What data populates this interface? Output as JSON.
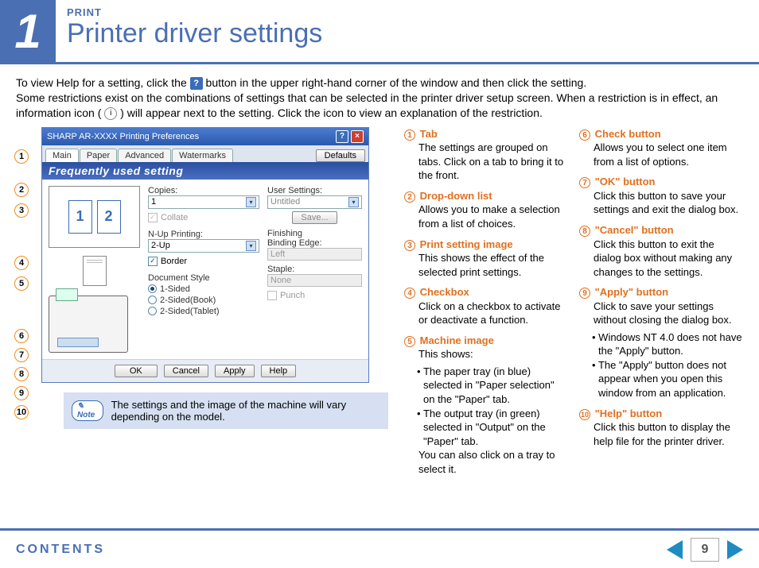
{
  "header": {
    "big_number": "1",
    "eyebrow": "PRINT",
    "title": "Printer driver settings"
  },
  "intro": {
    "line1a": "To view Help for a setting, click the ",
    "line1b": " button in the upper right-hand corner of the window and then click the setting.",
    "line2": "Some restrictions exist on the combinations of settings that can be selected in the printer driver setup screen. When a restriction is in effect, an information icon ( ",
    "line2b": " ) will appear next to the setting. Click the icon to view an explanation of the restriction."
  },
  "callout_labels": [
    "1",
    "2",
    "3",
    "4",
    "5",
    "6",
    "7",
    "8",
    "9",
    "10"
  ],
  "screenshot": {
    "title": "SHARP AR-XXXX Printing Preferences",
    "tabs": [
      "Main",
      "Paper",
      "Advanced",
      "Watermarks"
    ],
    "defaults_btn": "Defaults",
    "freq_bar": "Frequently used setting",
    "copies_label": "Copies:",
    "copies_value": "1",
    "collate_label": "Collate",
    "nup_label": "N-Up Printing:",
    "nup_value": "2-Up",
    "border_label": "Border",
    "docstyle_label": "Document Style",
    "radio1": "1-Sided",
    "radio2": "2-Sided(Book)",
    "radio3": "2-Sided(Tablet)",
    "usersettings_label": "User Settings:",
    "usersettings_value": "Untitled",
    "save_btn": "Save...",
    "finishing_label": "Finishing",
    "binding_label": "Binding Edge:",
    "binding_value": "Left",
    "staple_label": "Staple:",
    "staple_value": "None",
    "punch_label": "Punch",
    "ok_btn": "OK",
    "cancel_btn": "Cancel",
    "apply_btn": "Apply",
    "help_btn": "Help",
    "page1": "1",
    "page2": "2"
  },
  "note": {
    "pill": "Note",
    "text": "The settings and the image of the machine will vary depending on the model."
  },
  "explain": {
    "i1": {
      "title": "Tab",
      "body": "The settings are grouped on tabs. Click on a tab to bring it to the front."
    },
    "i2": {
      "title": "Drop-down list",
      "body": "Allows you to make a selection from a list of choices."
    },
    "i3": {
      "title": "Print setting image",
      "body": "This shows the effect of the selected print settings."
    },
    "i4": {
      "title": "Checkbox",
      "body": "Click on a checkbox to activate or deactivate a function."
    },
    "i5": {
      "title": "Machine image",
      "body_intro": "This shows:",
      "b1": "The paper tray (in blue) selected in \"Paper selection\" on the \"Paper\" tab.",
      "b2": "The output tray (in green) selected in \"Output\" on the \"Paper\" tab.",
      "body_out": "You can also click on a tray to select it."
    },
    "i6": {
      "title": "Check button",
      "body": "Allows you to select one item from a list of options."
    },
    "i7": {
      "title": "\"OK\" button",
      "body": "Click this button to save your settings and exit the dialog box."
    },
    "i8": {
      "title": "\"Cancel\" button",
      "body": "Click this button to exit the dialog box without making any changes to the settings."
    },
    "i9": {
      "title": "\"Apply\" button",
      "body": "Click to save your settings without closing the dialog box.",
      "b1": "Windows NT 4.0 does not have the \"Apply\" button.",
      "b2": "The \"Apply\" button does not appear when you open this window from an application."
    },
    "i10": {
      "title": "\"Help\" button",
      "body": "Click this button to display the help file for the printer driver."
    }
  },
  "footer": {
    "contents": "CONTENTS",
    "page": "9"
  }
}
